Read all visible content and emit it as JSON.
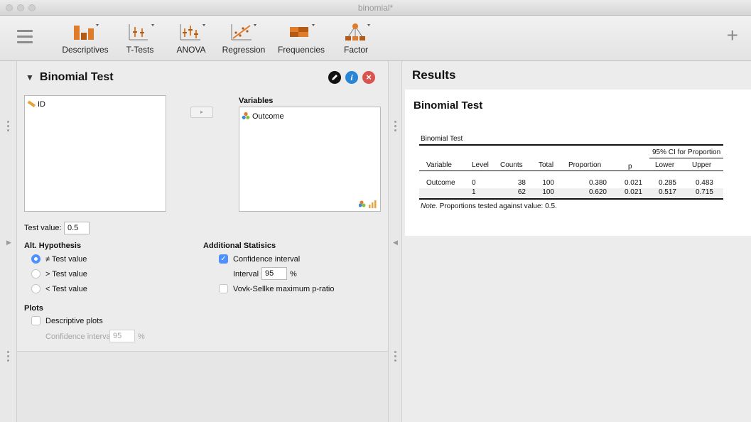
{
  "window": {
    "title": "binomial*"
  },
  "toolbar": {
    "items": [
      {
        "label": "Descriptives"
      },
      {
        "label": "T-Tests"
      },
      {
        "label": "ANOVA"
      },
      {
        "label": "Regression"
      },
      {
        "label": "Frequencies"
      },
      {
        "label": "Factor"
      }
    ],
    "accent": "#e07b2a"
  },
  "analysis": {
    "title": "Binomial Test",
    "info_icon": "i",
    "close_icon": "×",
    "available_vars": [
      {
        "name": "ID",
        "icon": "ruler-icon"
      }
    ],
    "variables_label": "Variables",
    "selected_vars": [
      {
        "name": "Outcome",
        "icon": "nominal-icon"
      }
    ],
    "move_glyph": "▸",
    "test_value_label": "Test value:",
    "test_value": "0.5",
    "alt_hypothesis_label": "Alt. Hypothesis",
    "alt_options": [
      {
        "label": "≠ Test value",
        "selected": true
      },
      {
        "label": "> Test value",
        "selected": false
      },
      {
        "label": "< Test value",
        "selected": false
      }
    ],
    "additional_label": "Additional Statisics",
    "ci_label": "Confidence interval",
    "ci_checked": true,
    "interval_label": "Interval",
    "interval_value": "95",
    "percent": "%",
    "vovk_label": "Vovk-Sellke maximum p-ratio",
    "plots_label": "Plots",
    "descriptive_plots_label": "Descriptive plots",
    "plot_ci_label": "Confidence interval",
    "plot_ci_value": "95",
    "plot_percent": "%"
  },
  "results": {
    "title": "Results",
    "heading": "Binomial Test",
    "table_caption": "Binomial Test",
    "ci_header": "95% CI for Proportion",
    "columns": [
      "Variable",
      "Level",
      "Counts",
      "Total",
      "Proportion",
      "p",
      "Lower",
      "Upper"
    ],
    "rows": [
      [
        "Outcome",
        "0",
        "38",
        "100",
        "0.380",
        "0.021",
        "0.285",
        "0.483"
      ],
      [
        "",
        "1",
        "62",
        "100",
        "0.620",
        "0.021",
        "0.517",
        "0.715"
      ]
    ],
    "note_prefix": "Note.",
    "note_text": " Proportions tested against value: 0.5."
  }
}
